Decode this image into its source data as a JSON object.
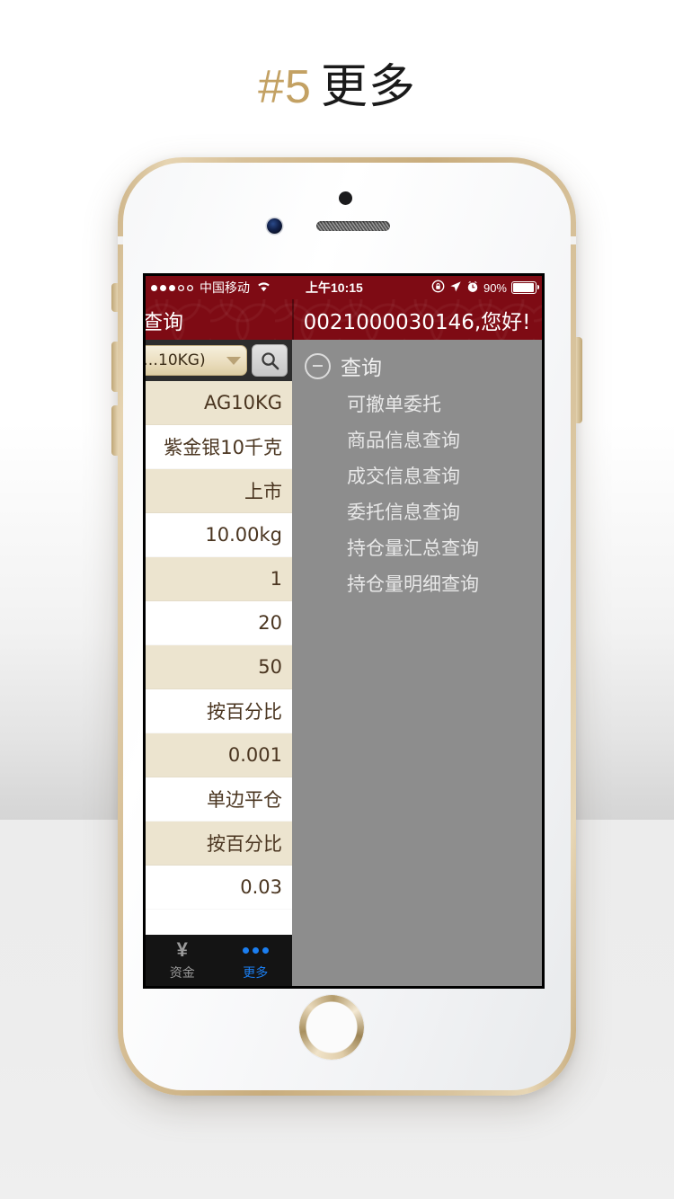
{
  "heading": {
    "number": "#5",
    "text": "更多",
    "number_color": "#c3a163",
    "text_color": "#1a1a1a"
  },
  "statusbar": {
    "signal_filled": 3,
    "signal_empty": 2,
    "carrier": "中国移动",
    "wifi_icon": "wifi-icon",
    "time": "上午10:15",
    "rotation_lock_icon": "rotation-lock-icon",
    "location_icon": "location-arrow-icon",
    "alarm_icon": "alarm-clock-icon",
    "battery_percent": "90%",
    "battery_level": 90
  },
  "titlebar": {
    "left_title": "查询",
    "right_title": "0021000030146,您好!",
    "background_color": "#7e0b14"
  },
  "search": {
    "dropdown_value": "…10KG)",
    "dropdown_caret_icon": "chevron-down-icon",
    "search_icon": "search-icon"
  },
  "detail_list": {
    "rows": [
      {
        "value": "AG10KG"
      },
      {
        "value": "紫金银10千克"
      },
      {
        "value": "上市"
      },
      {
        "value": "10.00kg"
      },
      {
        "value": "1"
      },
      {
        "value": "20"
      },
      {
        "value": "50"
      },
      {
        "value": "按百分比"
      },
      {
        "value": "0.001"
      },
      {
        "value": "单边平仓"
      },
      {
        "value": "按百分比"
      },
      {
        "value": "0.03"
      }
    ]
  },
  "menu": {
    "collapse_icon": "minus-circle-icon",
    "header": "查询",
    "items": [
      {
        "label": "可撤单委托"
      },
      {
        "label": "商品信息查询"
      },
      {
        "label": "成交信息查询"
      },
      {
        "label": "委托信息查询"
      },
      {
        "label": "持仓量汇总查询"
      },
      {
        "label": "持仓量明细查询"
      }
    ],
    "background_color": "#8d8d8d"
  },
  "tabbar": {
    "tabs": [
      {
        "icon": "yen-icon",
        "glyph": "¥",
        "label": "资金",
        "active": false
      },
      {
        "icon": "more-dots-icon",
        "glyph": "•••",
        "label": "更多",
        "active": true
      }
    ],
    "active_color": "#1b7ef0",
    "inactive_color": "#9a9a9a",
    "background_color": "#141414"
  }
}
